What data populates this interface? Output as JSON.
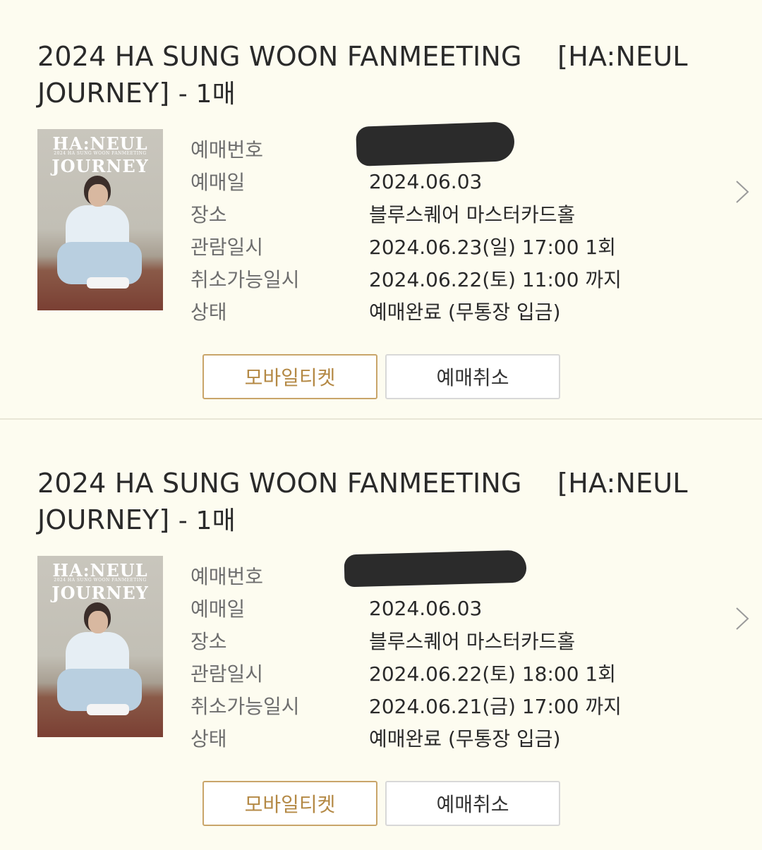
{
  "bookings": [
    {
      "title": "2024 HA SUNG WOON FANMEETING 　[HA:NEUL JOURNEY]",
      "quantity": "- 1매",
      "poster": {
        "title_line1": "HA:NEUL",
        "subtitle": "2024 HA SUNG WOON FANMEETING",
        "title_line2": "JOURNEY"
      },
      "rows": [
        {
          "label": "예매번호",
          "value": ""
        },
        {
          "label": "예매일",
          "value": "2024.06.03"
        },
        {
          "label": "장소",
          "value": "블루스퀘어 마스터카드홀"
        },
        {
          "label": "관람일시",
          "value": "2024.06.23(일) 17:00 1회"
        },
        {
          "label": "취소가능일시",
          "value": "2024.06.22(토) 11:00 까지"
        },
        {
          "label": "상태",
          "value": "예매완료 (무통장 입금)"
        }
      ],
      "mobile_ticket_label": "모바일티켓",
      "cancel_label": "예매취소"
    },
    {
      "title": "2024 HA SUNG WOON FANMEETING 　[HA:NEUL JOURNEY]",
      "quantity": "- 1매",
      "poster": {
        "title_line1": "HA:NEUL",
        "subtitle": "2024 HA SUNG WOON FANMEETING",
        "title_line2": "JOURNEY"
      },
      "rows": [
        {
          "label": "예매번호",
          "value": ""
        },
        {
          "label": "예매일",
          "value": "2024.06.03"
        },
        {
          "label": "장소",
          "value": "블루스퀘어 마스터카드홀"
        },
        {
          "label": "관람일시",
          "value": "2024.06.22(토) 18:00 1회"
        },
        {
          "label": "취소가능일시",
          "value": "2024.06.21(금) 17:00 까지"
        },
        {
          "label": "상태",
          "value": "예매완료 (무통장 입금)"
        }
      ],
      "mobile_ticket_label": "모바일티켓",
      "cancel_label": "예매취소"
    }
  ],
  "colors": {
    "background": "#fdfcf0",
    "mobile_button_accent": "#b48945",
    "label_text": "#6e6e6e",
    "value_text": "#2a2a2a"
  },
  "icons": {
    "chevron": "chevron-right-icon"
  }
}
